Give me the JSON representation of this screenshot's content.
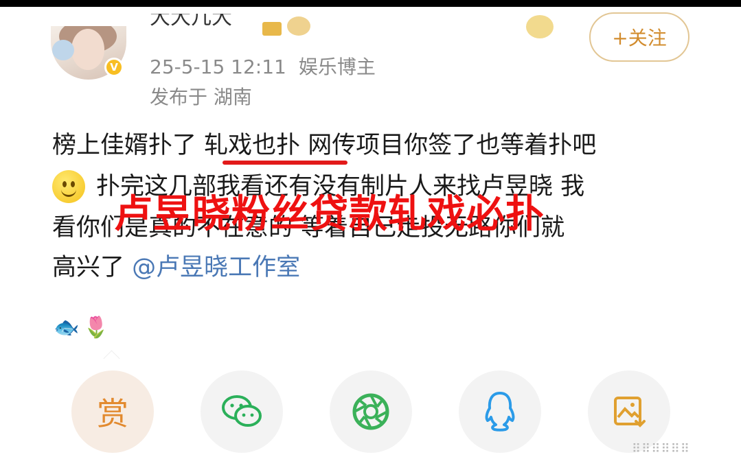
{
  "header": {
    "username_partial": "大大几大",
    "timestamp": "25-5-15 12:11",
    "user_role": "娱乐博主",
    "location": "发布于 湖南",
    "follow_label": "+关注",
    "verified_badge": "V"
  },
  "post": {
    "line1": "榜上佳婿扑了 轧戏也扑 网传项目你签了也等着扑吧",
    "line2": "扑完这几部我看还有没有制片人来找卢昱晓 我",
    "line3": "看你们是真的不在意的 等着自己走投无路你们就",
    "line4_text": "高兴了 ",
    "mention": "@卢昱晓工作室",
    "smile_emoji_icon": "smile-emoji-icon",
    "trailing_emojis": [
      "🐟",
      "🌷"
    ]
  },
  "overlay_caption": "卢昱晓粉丝贷款轧戏必扑",
  "share_bar": {
    "reward_label": "赏",
    "buttons": [
      "reward",
      "wechat",
      "moments",
      "qq",
      "save-image"
    ]
  },
  "watermark": "⠿⠿⠿⠿⠿⠿"
}
